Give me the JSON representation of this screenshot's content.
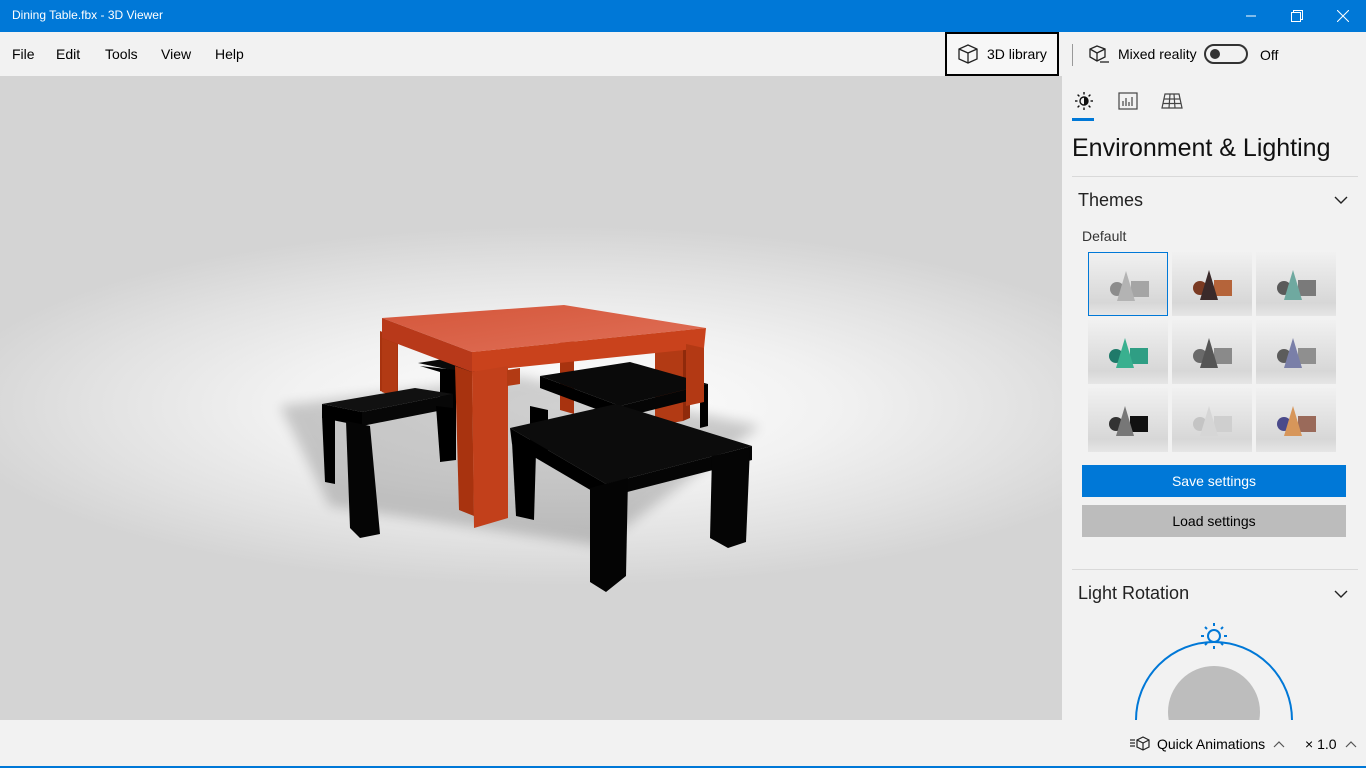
{
  "window": {
    "title": "Dining Table.fbx - 3D Viewer",
    "accent_color": "#0078d7"
  },
  "menu": {
    "items": [
      {
        "label": "File"
      },
      {
        "label": "Edit"
      },
      {
        "label": "Tools"
      },
      {
        "label": "View"
      },
      {
        "label": "Help"
      }
    ]
  },
  "toolbar": {
    "library_label": "3D library",
    "library_icon": "cube-icon",
    "mixed_reality_label": "Mixed reality",
    "mixed_reality_icon": "mixed-reality-icon",
    "mixed_reality_state": "Off"
  },
  "viewport": {
    "model": "Dining Table",
    "table_color": "#c8411d",
    "chair_color": "#050505"
  },
  "panel": {
    "tabs": [
      {
        "icon": "sun-icon",
        "selected": true
      },
      {
        "icon": "stats-icon",
        "selected": false
      },
      {
        "icon": "grid-icon",
        "selected": false
      }
    ],
    "title": "Environment & Lighting",
    "themes_header": "Themes",
    "theme_group_label": "Default",
    "themes": [
      {
        "selected": true
      },
      {
        "selected": false
      },
      {
        "selected": false
      },
      {
        "selected": false
      },
      {
        "selected": false
      },
      {
        "selected": false
      },
      {
        "selected": false
      },
      {
        "selected": false
      },
      {
        "selected": false
      }
    ],
    "save_label": "Save settings",
    "load_label": "Load settings",
    "light_rotation_header": "Light Rotation"
  },
  "status": {
    "quick_animations_label": "Quick Animations",
    "zoom_text": "× 1.0"
  }
}
